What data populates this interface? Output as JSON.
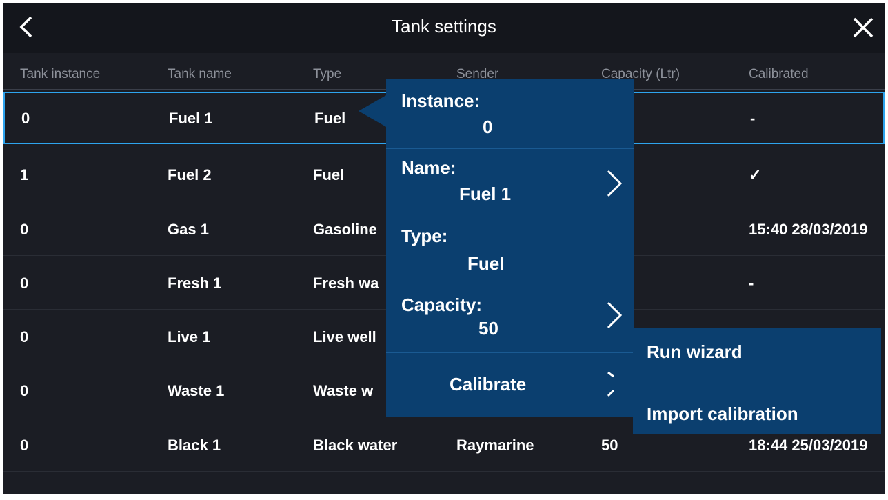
{
  "title": "Tank settings",
  "columns": [
    "Tank instance",
    "Tank name",
    "Type",
    "Sender",
    "Capacity (Ltr)",
    "Calibrated"
  ],
  "rows": [
    {
      "instance": "0",
      "name": "Fuel 1",
      "type": "Fuel",
      "sender": "",
      "capacity": "",
      "calibrated": "-"
    },
    {
      "instance": "1",
      "name": "Fuel 2",
      "type": "Fuel",
      "sender": "",
      "capacity": "",
      "calibrated": "✓"
    },
    {
      "instance": "0",
      "name": "Gas 1",
      "type": "Gasoline",
      "sender": "",
      "capacity": "",
      "calibrated": "15:40 28/03/2019"
    },
    {
      "instance": "0",
      "name": "Fresh 1",
      "type": "Fresh wa",
      "sender": "",
      "capacity": "",
      "calibrated": "-"
    },
    {
      "instance": "0",
      "name": "Live 1",
      "type": "Live well",
      "sender": "",
      "capacity": "",
      "calibrated": ""
    },
    {
      "instance": "0",
      "name": "Waste 1",
      "type": "Waste w",
      "sender": "",
      "capacity": "",
      "calibrated": ""
    },
    {
      "instance": "0",
      "name": "Black 1",
      "type": "Black water",
      "sender": "Raymarine",
      "capacity": "50",
      "calibrated": "18:44 25/03/2019"
    }
  ],
  "popup": {
    "instance_label": "Instance:",
    "instance_value": "0",
    "name_label": "Name:",
    "name_value": "Fuel 1",
    "type_label": "Type:",
    "type_value": "Fuel",
    "capacity_label": "Capacity:",
    "capacity_value": "50",
    "calibrate_label": "Calibrate"
  },
  "submenu": {
    "run_wizard": "Run wizard",
    "import_calibration": "Import calibration"
  },
  "icons": {
    "back": "chevron-left-icon",
    "close": "close-icon",
    "chevron": "chevron-right-icon"
  },
  "colors": {
    "background": "#1b1d24",
    "popup": "#0b3f6f",
    "selection": "#2ea4ee"
  }
}
